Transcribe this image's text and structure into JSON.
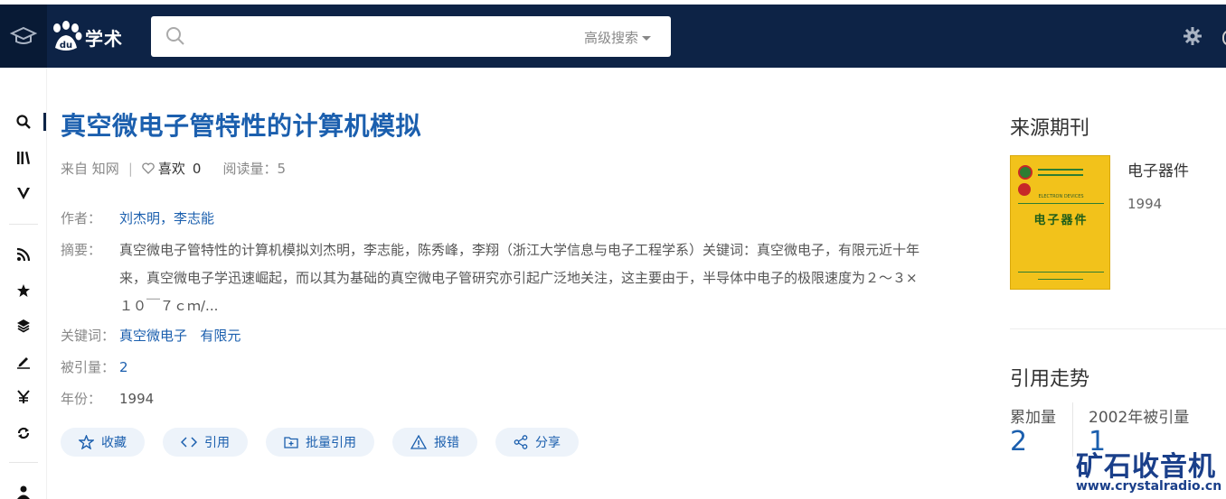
{
  "header": {
    "logo_text": "学术",
    "logo_paw_text": "du",
    "search_placeholder": "",
    "advanced_search": "高级搜索"
  },
  "paper": {
    "title": "真空微电子管特性的计算机模拟",
    "source_label": "来自",
    "source": "知网",
    "like_label": "喜欢",
    "like_count": "0",
    "read_label": "阅读量：",
    "read_count": "5",
    "author_label": "作者：",
    "authors": "刘杰明，李志能",
    "abstract_label": "摘要：",
    "abstract": "真空微电子管特性的计算机模拟刘杰明，李志能，陈秀峰，李翔（浙江大学信息与电子工程学系）关键词：真空微电子，有限元近十年来，真空微电子学迅速崛起，而以其为基础的真空微电子管研究亦引起广泛地关注，这主要由于，半导体中电子的极限速度为２～３×１０￣７ｃｍ/...",
    "keywords_label": "关键词：",
    "keywords": [
      "真空微电子",
      "有限元"
    ],
    "cited_label": "被引量：",
    "cited": "2",
    "year_label": "年份：",
    "year": "1994"
  },
  "actions": [
    {
      "label": "收藏",
      "icon": "star-outline-icon"
    },
    {
      "label": "引用",
      "icon": "code-icon"
    },
    {
      "label": "批量引用",
      "icon": "folder-plus-icon"
    },
    {
      "label": "报错",
      "icon": "warning-icon"
    },
    {
      "label": "分享",
      "icon": "share-icon"
    }
  ],
  "sidebar": {
    "source_heading": "来源期刊",
    "journal_name": "电子器件",
    "journal_year": "1994",
    "cover_title": "电子器件",
    "cover_en": "ELECTRON DEVICES",
    "trend_heading": "引用走势",
    "cumulative_label": "累加量",
    "cumulative_value": "2",
    "year_cited_label": "2002年被引量",
    "year_cited_value": "1"
  },
  "rail": {
    "icons": [
      "search-icon",
      "library-icon",
      "v-icon",
      "rss-icon",
      "star-icon",
      "layers-icon",
      "pen-icon",
      "yen-icon",
      "refresh-icon",
      "user-icon"
    ]
  },
  "watermark": {
    "cn": "矿石收音机",
    "url": "www.crystalradio.cn"
  }
}
